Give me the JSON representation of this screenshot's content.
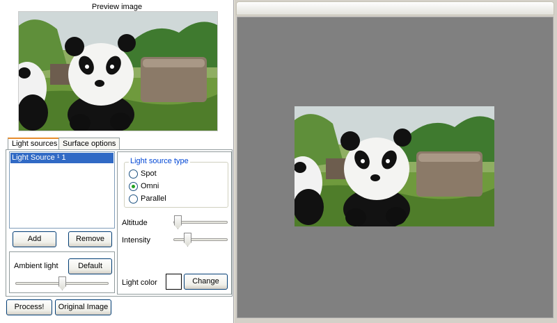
{
  "preview": {
    "title": "Preview image"
  },
  "tabs": [
    {
      "label": "Light sources",
      "active": true
    },
    {
      "label": "Surface options",
      "active": false
    }
  ],
  "light_sources": {
    "items": [
      "Light Source ¹ 1"
    ]
  },
  "buttons": {
    "add": "Add",
    "remove": "Remove",
    "default": "Default",
    "change": "Change",
    "process": "Process!",
    "original": "Original Image"
  },
  "ambient": {
    "label": "Ambient light",
    "value": 0.5
  },
  "light_type": {
    "legend": "Light source type",
    "options": [
      "Spot",
      "Omni",
      "Parallel"
    ],
    "selected": "Omni"
  },
  "altitude": {
    "label": "Altitude",
    "value": 0.05
  },
  "intensity": {
    "label": "Intensity",
    "value": 0.2
  },
  "light_color": {
    "label": "Light color",
    "color": "#ffffff"
  },
  "colors": {
    "canvas_bg": "#808080",
    "selection": "#316ac5",
    "legend": "#0046d5"
  }
}
